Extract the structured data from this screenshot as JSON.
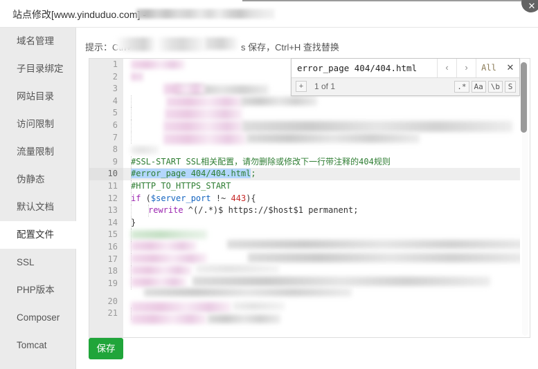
{
  "window": {
    "title": "站点修改[www.yinduduo.com] - ",
    "title_redacted": true,
    "close_icon": "close-icon"
  },
  "sidebar": {
    "items": [
      {
        "label": "域名管理",
        "active": false
      },
      {
        "label": "子目录绑定",
        "active": false
      },
      {
        "label": "网站目录",
        "active": false
      },
      {
        "label": "访问限制",
        "active": false
      },
      {
        "label": "流量限制",
        "active": false
      },
      {
        "label": "伪静态",
        "active": false
      },
      {
        "label": "默认文档",
        "active": false
      },
      {
        "label": "配置文件",
        "active": true
      },
      {
        "label": "SSL",
        "active": false
      },
      {
        "label": "PHP版本",
        "active": false
      },
      {
        "label": "Composer",
        "active": false
      },
      {
        "label": "Tomcat",
        "active": false
      }
    ]
  },
  "main": {
    "tip_prefix": "提示：Ctrl+",
    "tip_suffix": "s 保存，Ctrl+H 查找替换",
    "save_label": "保存"
  },
  "search": {
    "query": "error_page 404/404.html",
    "prev_label": "‹",
    "next_label": "›",
    "all_label": "All",
    "close_label": "✕",
    "plus_label": "+",
    "count_label": "1 of 1",
    "options": [
      ".*",
      "Aa",
      "\\b",
      "S"
    ]
  },
  "editor": {
    "current_line": 10,
    "line_numbers": [
      1,
      2,
      3,
      4,
      5,
      6,
      7,
      8,
      9,
      10,
      11,
      12,
      13,
      14,
      15,
      16,
      17,
      18,
      19,
      20,
      21
    ],
    "lines": [
      {
        "n": 1,
        "redacted": true,
        "text": ""
      },
      {
        "n": 2,
        "redacted": true,
        "text": ""
      },
      {
        "n": 3,
        "redacted": true,
        "text": ""
      },
      {
        "n": 4,
        "redacted": true,
        "text": ""
      },
      {
        "n": 5,
        "redacted": true,
        "text": ""
      },
      {
        "n": 6,
        "redacted": true,
        "text": ""
      },
      {
        "n": 7,
        "redacted": true,
        "text": ""
      },
      {
        "n": 8,
        "redacted": true,
        "text": ""
      },
      {
        "n": 9,
        "redacted": false,
        "text": "#SSL-START SSL相关配置，请勿删除或修改下一行带注释的404规则"
      },
      {
        "n": 10,
        "redacted": false,
        "text": "#error_page 404/404.html;"
      },
      {
        "n": 11,
        "redacted": false,
        "text": "#HTTP_TO_HTTPS_START"
      },
      {
        "n": 12,
        "redacted": false,
        "text": "if ($server_port !~ 443){"
      },
      {
        "n": 13,
        "redacted": false,
        "text": "    rewrite ^(/.*)$ https://$host$1 permanent;"
      },
      {
        "n": 14,
        "redacted": false,
        "text": "}"
      },
      {
        "n": 15,
        "redacted": true,
        "text": ""
      },
      {
        "n": 16,
        "redacted": true,
        "text": ""
      },
      {
        "n": 17,
        "redacted": true,
        "text": ""
      },
      {
        "n": 18,
        "redacted": true,
        "text": ""
      },
      {
        "n": 19,
        "redacted": true,
        "text": ""
      },
      {
        "n": 20,
        "redacted": true,
        "text": ""
      },
      {
        "n": 21,
        "redacted": true,
        "text": ""
      }
    ],
    "line9_tokens": {
      "comment": "#SSL-START SSL相关配置，请勿删除或修改下一行带注释的404规则"
    },
    "line10_tokens": {
      "match": "#error_page 404/404.html",
      "semi": ";"
    },
    "line11_tokens": {
      "comment": "#HTTP_TO_HTTPS_START"
    },
    "line12_tokens": {
      "kw": "if",
      "open": " (",
      "var": "$server_port",
      "op": " !~ ",
      "num": "443",
      "close": "){"
    },
    "line13_tokens": {
      "kw": "rewrite",
      "rest": " ^(/.*)$ https://$host$1 permanent;"
    },
    "line14_tokens": {
      "brace": "}"
    }
  },
  "colors": {
    "accent_green": "#20a53a",
    "comment": "#2e7d32",
    "keyword": "#9c27b0",
    "variable": "#1565c0",
    "number": "#c62828",
    "match_highlight": "#b4d7fd",
    "sidebar_bg": "#ebebeb",
    "gutter_bg": "#ebebeb"
  }
}
